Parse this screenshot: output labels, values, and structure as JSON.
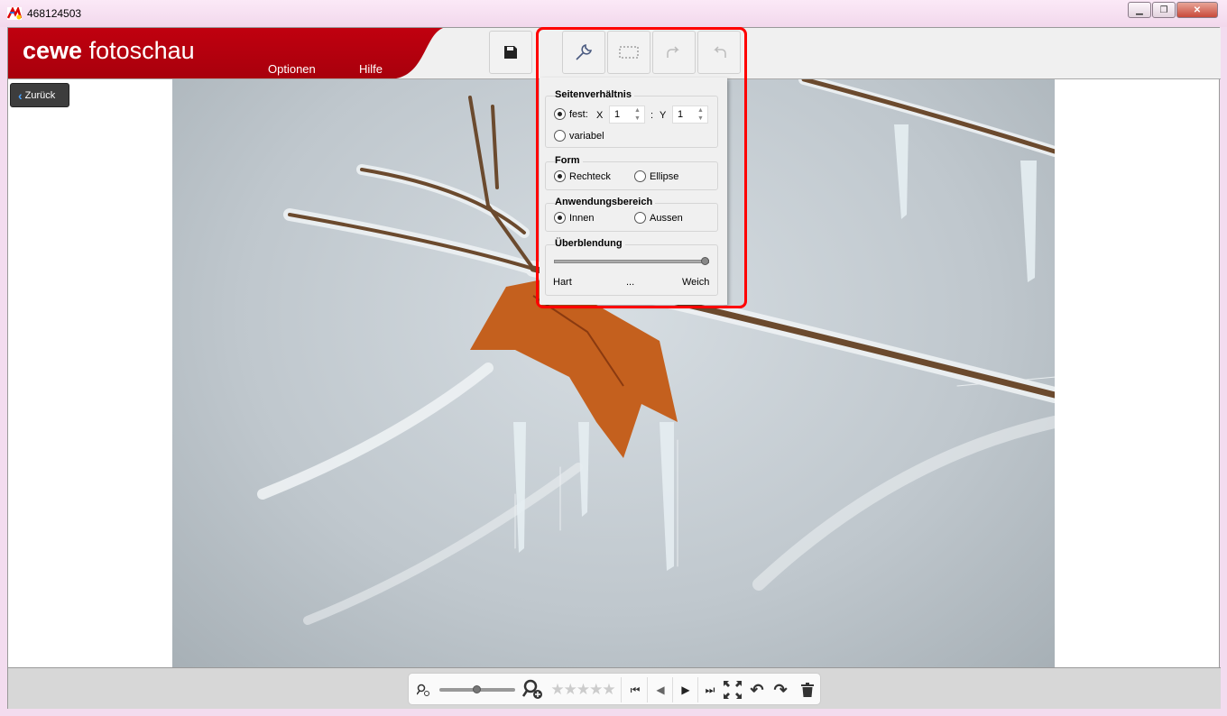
{
  "window": {
    "title": "468124503"
  },
  "header": {
    "brand_bold": "cewe",
    "brand_light": "fotoschau",
    "menu": [
      "Optionen",
      "Hilfe"
    ],
    "brand_color": "#b5000f"
  },
  "toolbar": {
    "buttons": [
      "save-icon",
      "wrench-icon",
      "crop-rect-icon",
      "redo-disabled-icon",
      "undo-disabled-icon"
    ]
  },
  "nav": {
    "back_label": "Zurück"
  },
  "panel": {
    "aspect": {
      "title": "Seitenverhältnis",
      "fixed_label": "fest:",
      "x_label": "X",
      "x_value": "1",
      "sep": ":",
      "y_label": "Y",
      "y_value": "1",
      "variable_label": "variabel",
      "selected": "fest"
    },
    "form": {
      "title": "Form",
      "options": [
        "Rechteck",
        "Ellipse"
      ],
      "selected": "Rechteck"
    },
    "area": {
      "title": "Anwendungsbereich",
      "options": [
        "Innen",
        "Aussen"
      ],
      "selected": "Innen"
    },
    "blend": {
      "title": "Überblendung",
      "min_label": "Hart",
      "mid_label": "...",
      "max_label": "Weich",
      "value": 0.97
    }
  },
  "bottom": {
    "zoom_value": 0.5,
    "rating": 0,
    "rating_max": 5
  }
}
